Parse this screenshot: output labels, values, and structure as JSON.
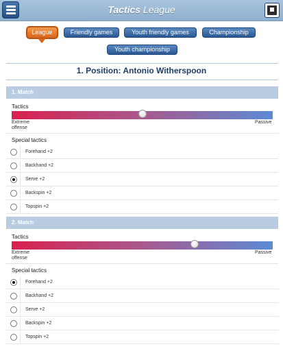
{
  "header": {
    "title_bold": "Tactics",
    "title_rest": " League"
  },
  "tabs": [
    {
      "label": "League",
      "active": true
    },
    {
      "label": "Friendly games",
      "active": false
    },
    {
      "label": "Youth friendly games",
      "active": false
    },
    {
      "label": "Championship",
      "active": false
    },
    {
      "label": "Youth championship",
      "active": false
    }
  ],
  "position_title": "1. Position: Antonio Witherspoon",
  "matches": [
    {
      "title": "1. Match",
      "tactics_label": "Tactics",
      "slider_left_label": "Extreme offense",
      "slider_right_label": "Passive",
      "slider_value_fraction": 0.5,
      "special_label": "Special tactics",
      "options": [
        {
          "label": "Forehand +2",
          "checked": false
        },
        {
          "label": "Backhand +2",
          "checked": false
        },
        {
          "label": "Serve +2",
          "checked": true
        },
        {
          "label": "Backspin +2",
          "checked": false
        },
        {
          "label": "Topspin +2",
          "checked": false
        }
      ]
    },
    {
      "title": "2. Match",
      "tactics_label": "Tactics",
      "slider_left_label": "Extreme offense",
      "slider_right_label": "Passive",
      "slider_value_fraction": 0.7,
      "special_label": "Special tactics",
      "options": [
        {
          "label": "Forehand +2",
          "checked": true
        },
        {
          "label": "Backhand +2",
          "checked": false
        },
        {
          "label": "Serve +2",
          "checked": false
        },
        {
          "label": "Backspin +2",
          "checked": false
        },
        {
          "label": "Topspin +2",
          "checked": false
        }
      ]
    }
  ]
}
